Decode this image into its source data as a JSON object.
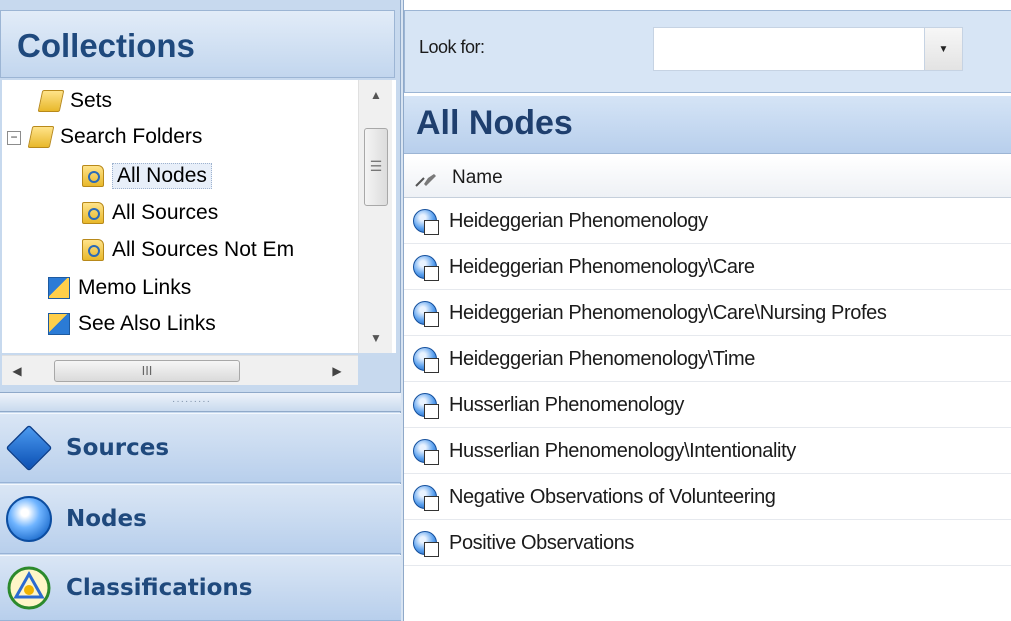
{
  "left_pane": {
    "title": "Collections",
    "tree": [
      {
        "label": "Sets",
        "icon": "sets-folder-icon"
      },
      {
        "label": "Search Folders",
        "icon": "search-folders-icon",
        "expander": "−"
      },
      {
        "label": "All Nodes",
        "icon": "search-folder-icon",
        "selected": true
      },
      {
        "label": "All Sources",
        "icon": "search-folder-icon"
      },
      {
        "label": "All Sources Not Em",
        "icon": "search-folder-icon"
      },
      {
        "label": "Memo Links",
        "icon": "memo-links-icon"
      },
      {
        "label": "See Also Links",
        "icon": "see-also-links-icon"
      }
    ],
    "scroll_arrows": {
      "up": "▲",
      "down": "▼",
      "left": "◀",
      "right": "▶",
      "grip_v": "☰",
      "grip_h": "III"
    },
    "splitter_grip": "·········",
    "nav_buttons": [
      {
        "label": "Sources",
        "icon": "sources-icon"
      },
      {
        "label": "Nodes",
        "icon": "nodes-icon"
      },
      {
        "label": "Classifications",
        "icon": "classifications-icon"
      }
    ]
  },
  "toolbar": {
    "look_for_label": "Look for:",
    "look_for_value": "",
    "dropdown_arrow": "▼"
  },
  "list": {
    "title": "All Nodes",
    "column_name": "Name",
    "rows": [
      "Heideggerian Phenomenology",
      "Heideggerian Phenomenology\\Care",
      "Heideggerian Phenomenology\\Care\\Nursing Profes",
      "Heideggerian Phenomenology\\Time",
      "Husserlian Phenomenology",
      "Husserlian Phenomenology\\Intentionality",
      "Negative Observations of Volunteering",
      "Positive Observations"
    ]
  },
  "colors": {
    "accent": "#1f497d",
    "pane_bg": "#c7d9ee",
    "header_bg": "#d5e4f6"
  }
}
